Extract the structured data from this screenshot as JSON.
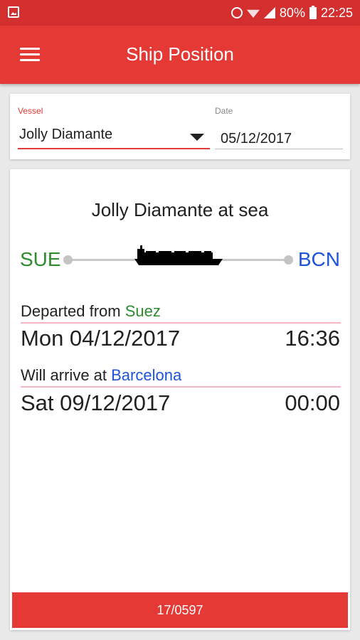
{
  "status_bar": {
    "battery": "80%",
    "time": "22:25"
  },
  "app_bar": {
    "title": "Ship Position"
  },
  "filters": {
    "vessel_label": "Vessel",
    "vessel_value": "Jolly Diamante",
    "date_label": "Date",
    "date_value": "05/12/2017"
  },
  "voyage": {
    "status_title": "Jolly Diamante at sea",
    "origin_code": "SUE",
    "destination_code": "BCN",
    "departed_prefix": "Departed from ",
    "departed_port": "Suez",
    "departed_date": "Mon 04/12/2017",
    "departed_time": "16:36",
    "arrive_prefix": "Will arrive at ",
    "arrive_port": "Barcelona",
    "arrive_date": "Sat 09/12/2017",
    "arrive_time": "00:00",
    "colors": {
      "origin": "#2e8b2e",
      "destination": "#1e54d8",
      "accent": "#e53935"
    }
  },
  "bottom_bar": {
    "voyage_number": "17/0597"
  }
}
